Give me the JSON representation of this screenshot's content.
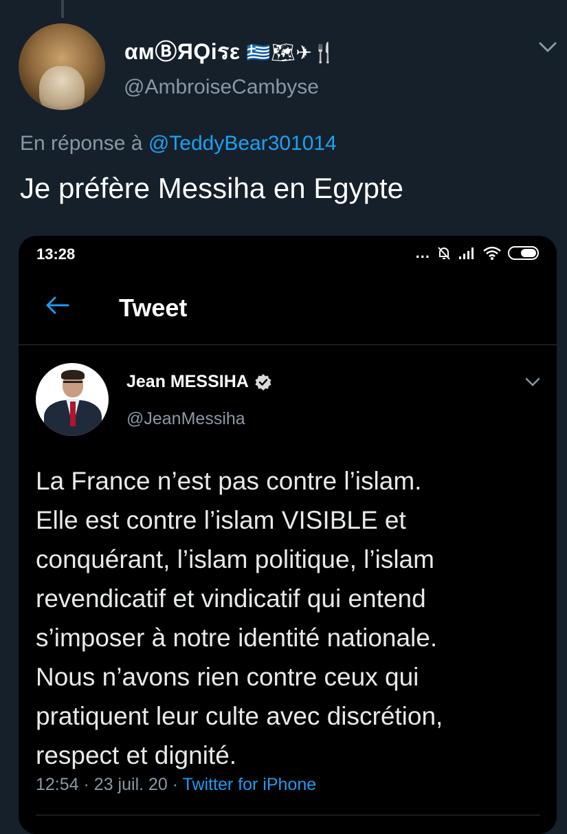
{
  "tweet": {
    "display_name_text": "αмⒷЯϘiรε",
    "display_name_emojis": "🇬🇷🗺✈🍴",
    "handle": "@AmbroiseCambyse",
    "reply_prefix": "En réponse à",
    "reply_to": "@TeddyBear301014",
    "text": "Je préfère Messiha en Egypte"
  },
  "screenshot": {
    "status_bar": {
      "time": "13:28",
      "dots": "..."
    },
    "header": {
      "title": "Tweet"
    },
    "quoted_tweet": {
      "name": "Jean MESSIHA",
      "handle": "@JeanMessiha",
      "lines": [
        "La France n’est pas contre l’islam.",
        "Elle est contre l’islam VISIBLE et",
        "conquérant, l’islam politique, l’islam",
        "revendicatif et vindicatif qui entend",
        "s’imposer à notre identité nationale.",
        "Nous n’avons rien contre ceux qui",
        "pratiquent leur culte avec discrétion,",
        "respect et dignité."
      ],
      "time": "12:54",
      "separator": "·",
      "date": "23 juil. 20",
      "source": "Twitter for iPhone"
    }
  },
  "colors": {
    "background": "#15202b",
    "link": "#1da1f2",
    "muted": "#8899a6"
  },
  "icons": [
    "caret-down-icon",
    "back-arrow-icon",
    "verified-badge-icon",
    "mute-bell-icon",
    "signal-icon",
    "wifi-icon",
    "battery-icon"
  ]
}
